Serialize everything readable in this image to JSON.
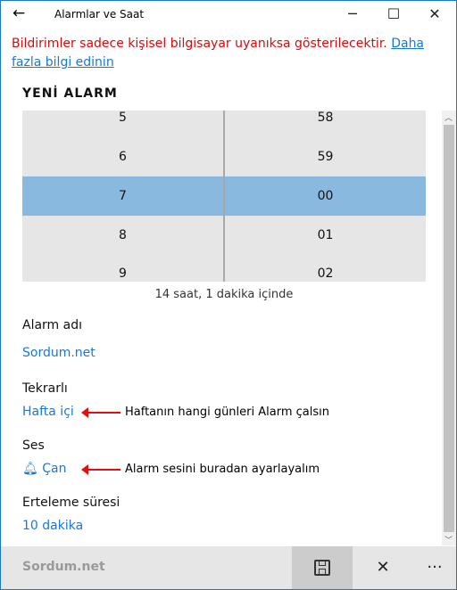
{
  "window": {
    "title": "Alarmlar ve Saat",
    "accent": "#1979ca"
  },
  "warning": {
    "text": "Bildirimler sadece kişisel bilgisayar uyanıksa gösterilecektir. ",
    "link": "Daha fazla bilgi edinin"
  },
  "heading": "YENİ ALARM",
  "picker": {
    "hours": [
      "5",
      "6",
      "7",
      "8",
      "9"
    ],
    "minutes": [
      "58",
      "59",
      "00",
      "01",
      "02"
    ],
    "selected_hour": "7",
    "selected_minute": "00"
  },
  "time_until": "14 saat, 1 dakika içinde",
  "fields": [
    {
      "label": "Alarm adı",
      "value": "Sordum.net"
    },
    {
      "label": "Tekrarlı",
      "value": "Hafta içi"
    },
    {
      "label": "Ses",
      "value": "Çan"
    },
    {
      "label": "Erteleme süresi",
      "value": "10 dakika"
    }
  ],
  "annotations": {
    "repeat": "Haftanın hangi günleri Alarm çalsın",
    "sound": "Alarm sesini buradan ayarlayalım"
  },
  "bottom_bar": {
    "watermark": "Sordum.net"
  }
}
